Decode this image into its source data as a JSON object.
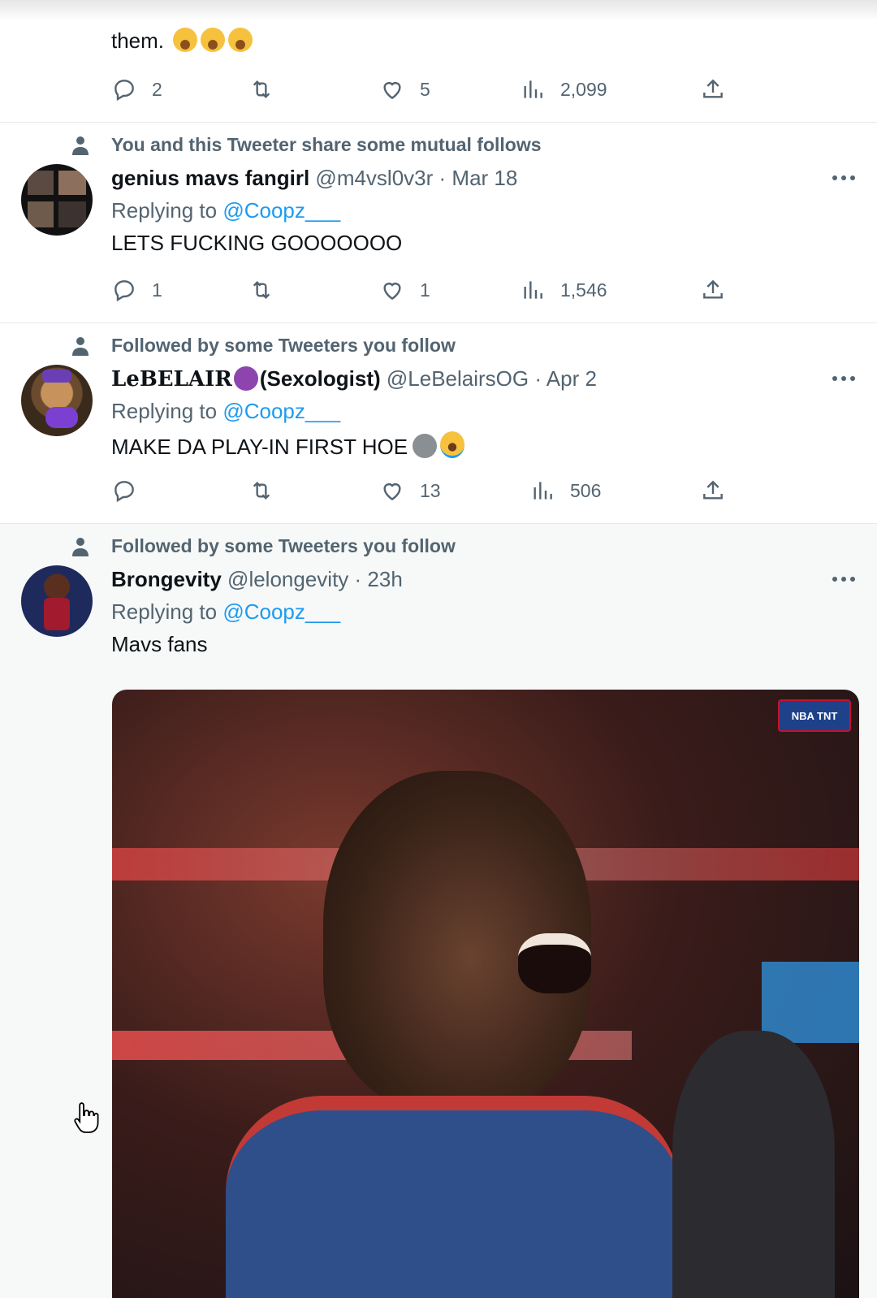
{
  "tweets": [
    {
      "body": "them.",
      "body_emojis": [
        "laugh-cry-emoji",
        "laugh-cry-emoji",
        "laugh-cry-emoji"
      ],
      "replies": "2",
      "retweets": "",
      "likes": "5",
      "views": "2,099"
    },
    {
      "social_context": "You and this Tweeter share some mutual follows",
      "name": "genius mavs fangirl",
      "handle": "@m4vsl0v3r",
      "date": "· Mar 18",
      "replying_label": "Replying to",
      "replying_to": "@Coopz___",
      "body": "LETS FUCKING GOOOOOOO",
      "replies": "1",
      "retweets": "",
      "likes": "1",
      "views": "1,546"
    },
    {
      "social_context": "Followed by some Tweeters you follow",
      "name": "LeBELAIR",
      "name_suffix": "(Sexologist)",
      "name_emoji": "devil-emoji",
      "handle": "@LeBelairsOG",
      "date": "· Apr 2",
      "replying_label": "Replying to",
      "replying_to": "@Coopz___",
      "body": "MAKE DA PLAY-IN FIRST HOE",
      "body_emojis": [
        "skull-emoji",
        "crying-emoji"
      ],
      "replies": "",
      "retweets": "",
      "likes": "13",
      "views": "506"
    },
    {
      "social_context": "Followed by some Tweeters you follow",
      "name": "Brongevity",
      "handle": "@lelongevity",
      "date": "· 23h",
      "replying_label": "Replying to",
      "replying_to": "@Coopz___",
      "body": "Mavs fans",
      "media_badge": "NBA TNT"
    }
  ],
  "colors": {
    "link": "#1d9bf0",
    "secondary_text": "#536471",
    "hover_background": "#f7f9f9",
    "separator": "#e7e9ea"
  }
}
